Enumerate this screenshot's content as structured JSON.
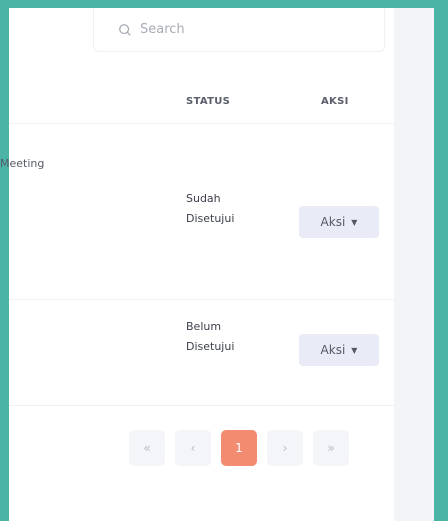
{
  "search": {
    "placeholder": "Search"
  },
  "table": {
    "headers": {
      "status": "STATUS",
      "aksi": "AKSI"
    },
    "rows": [
      {
        "purpose": "Meeting",
        "status_line1": "Sudah",
        "status_line2": "Disetujui",
        "action": "Aksi"
      },
      {
        "purpose": "",
        "status_line1": "Belum",
        "status_line2": "Disetujui",
        "action": "Aksi"
      }
    ]
  },
  "pagination": {
    "first": "«",
    "prev": "‹",
    "current": "1",
    "next": "›",
    "last": "»"
  },
  "colors": {
    "frame": "#4bb4a6",
    "active_page": "#f28b70",
    "action_button": "#e9ebf6"
  }
}
